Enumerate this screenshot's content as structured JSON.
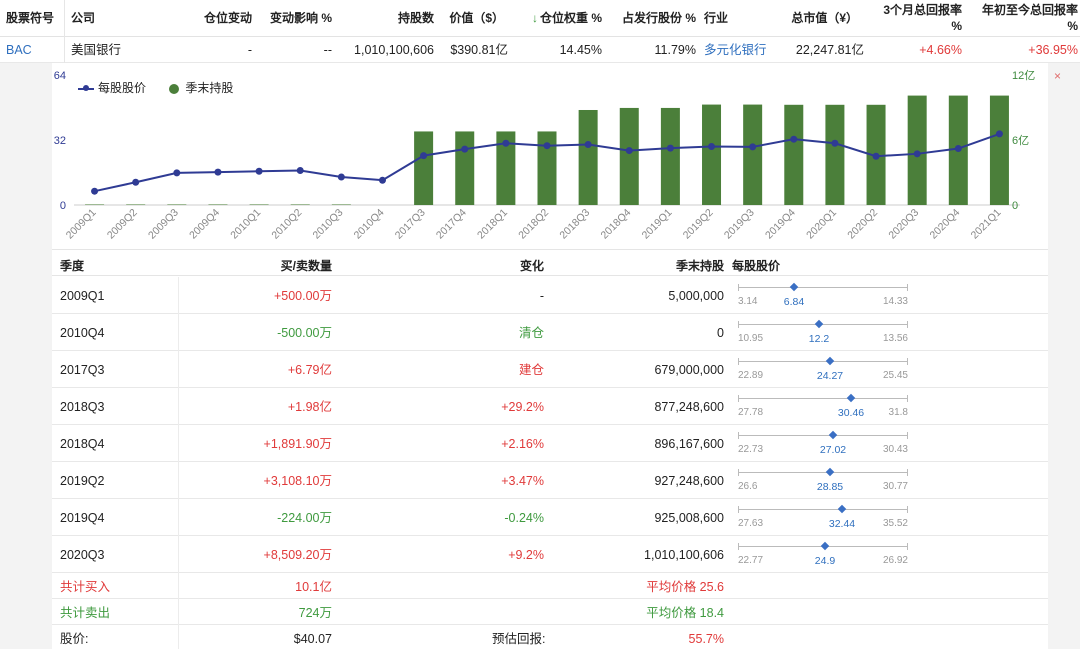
{
  "header": {
    "columns": [
      "股票符号",
      "公司",
      "仓位变动",
      "变动影响 %",
      "持股数",
      "价值（$）",
      "仓位权重 %",
      "占发行股份 %",
      "行业",
      "总市值（¥）",
      "3个月总回报率",
      "%",
      "年初至今总回报率",
      "%"
    ],
    "sort_arrow": "↓"
  },
  "holding": {
    "symbol": "BAC",
    "company": "美国银行",
    "position_change": "-",
    "change_impact": "--",
    "shares": "1,010,100,606",
    "value": "$390.81亿",
    "weight": "14.45%",
    "pct_outstanding": "11.79%",
    "industry": "多元化银行",
    "market_cap": "22,247.81亿",
    "return_3m": "+4.66%",
    "return_ytd": "+36.95%"
  },
  "panel": {
    "close": "×"
  },
  "chart_data": {
    "type": "bar",
    "legend": [
      "每股股价",
      "季末持股"
    ],
    "left_axis": {
      "ticks": [
        "64",
        "32",
        "0"
      ],
      "ylim": [
        0,
        64
      ]
    },
    "right_axis": {
      "ticks": [
        "12亿",
        "6亿",
        "0"
      ],
      "ylim": [
        0,
        12
      ]
    },
    "categories": [
      "2009Q1",
      "2009Q2",
      "2009Q3",
      "2009Q4",
      "2010Q1",
      "2010Q2",
      "2010Q3",
      "2010Q4",
      "2017Q3",
      "2017Q4",
      "2018Q1",
      "2018Q2",
      "2018Q3",
      "2018Q4",
      "2019Q1",
      "2019Q2",
      "2019Q3",
      "2019Q4",
      "2020Q1",
      "2020Q2",
      "2020Q3",
      "2020Q4",
      "2021Q1"
    ],
    "series": [
      {
        "name": "季末持股",
        "axis": "right",
        "values": [
          0.05,
          0.05,
          0.05,
          0.05,
          0.05,
          0.05,
          0.05,
          0,
          6.79,
          6.79,
          6.79,
          6.79,
          8.77,
          8.96,
          8.96,
          9.27,
          9.27,
          9.25,
          9.25,
          9.25,
          10.1,
          10.1,
          10.1
        ]
      },
      {
        "name": "每股股价",
        "axis": "left",
        "values": [
          6.8,
          11.2,
          15.8,
          16.2,
          16.6,
          17.0,
          13.8,
          12.2,
          24.3,
          27.5,
          30.4,
          29.2,
          29.8,
          26.8,
          28.0,
          28.8,
          28.6,
          32.4,
          30.4,
          24.0,
          25.2,
          27.8,
          35.0
        ]
      }
    ]
  },
  "table": {
    "headers": [
      "季度",
      "买/卖数量",
      "变化",
      "季末持股",
      "每股股价"
    ],
    "rows": [
      {
        "quarter": "2009Q1",
        "qty": "+500.00万",
        "qty_color": "red",
        "chg": "-",
        "chg_color": "dark",
        "holding": "5,000,000",
        "lo": "3.14",
        "price": "6.84",
        "hi": "14.33"
      },
      {
        "quarter": "2010Q4",
        "qty": "-500.00万",
        "qty_color": "green",
        "chg": "清仓",
        "chg_color": "green",
        "holding": "0",
        "lo": "10.95",
        "price": "12.2",
        "hi": "13.56"
      },
      {
        "quarter": "2017Q3",
        "qty": "+6.79亿",
        "qty_color": "red",
        "chg": "建仓",
        "chg_color": "red",
        "holding": "679,000,000",
        "lo": "22.89",
        "price": "24.27",
        "hi": "25.45"
      },
      {
        "quarter": "2018Q3",
        "qty": "+1.98亿",
        "qty_color": "red",
        "chg": "+29.2%",
        "chg_color": "red",
        "holding": "877,248,600",
        "lo": "27.78",
        "price": "30.46",
        "hi": "31.8"
      },
      {
        "quarter": "2018Q4",
        "qty": "+1,891.90万",
        "qty_color": "red",
        "chg": "+2.16%",
        "chg_color": "red",
        "holding": "896,167,600",
        "lo": "22.73",
        "price": "27.02",
        "hi": "30.43"
      },
      {
        "quarter": "2019Q2",
        "qty": "+3,108.10万",
        "qty_color": "red",
        "chg": "+3.47%",
        "chg_color": "red",
        "holding": "927,248,600",
        "lo": "26.6",
        "price": "28.85",
        "hi": "30.77"
      },
      {
        "quarter": "2019Q4",
        "qty": "-224.00万",
        "qty_color": "green",
        "chg": "-0.24%",
        "chg_color": "green",
        "holding": "925,008,600",
        "lo": "27.63",
        "price": "32.44",
        "hi": "35.52"
      },
      {
        "quarter": "2020Q3",
        "qty": "+8,509.20万",
        "qty_color": "red",
        "chg": "+9.2%",
        "chg_color": "red",
        "holding": "1,010,100,606",
        "lo": "22.77",
        "price": "24.9",
        "hi": "26.92"
      }
    ]
  },
  "summary": {
    "buy_label": "共计买入",
    "buy_value": "10.1亿",
    "buy_avg": "平均价格 25.6",
    "sell_label": "共计卖出",
    "sell_value": "724万",
    "sell_avg": "平均价格 18.4",
    "price_label": "股价:",
    "price_value": "$40.07",
    "return_label": "预估回报:",
    "return_value": "55.7%"
  }
}
